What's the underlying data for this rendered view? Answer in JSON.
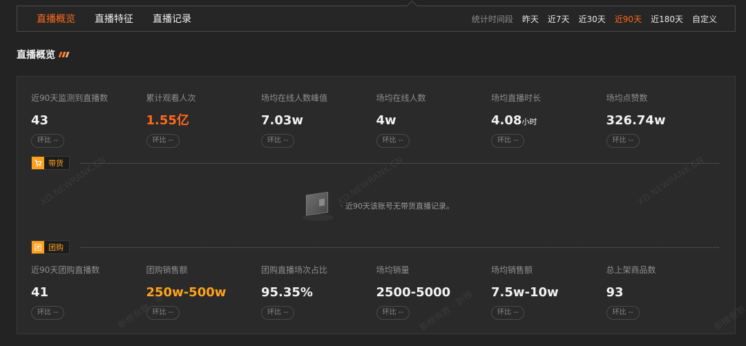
{
  "tabs": [
    {
      "label": "直播概览",
      "active": true
    },
    {
      "label": "直播特征",
      "active": false
    },
    {
      "label": "直播记录",
      "active": false
    }
  ],
  "period": {
    "label": "统计时间段",
    "options": [
      {
        "label": "昨天",
        "active": false
      },
      {
        "label": "近7天",
        "active": false
      },
      {
        "label": "近30天",
        "active": false
      },
      {
        "label": "近90天",
        "active": true
      },
      {
        "label": "近180天",
        "active": false
      },
      {
        "label": "自定义",
        "active": false
      }
    ]
  },
  "section_title": "直播概览",
  "overview_stats": [
    {
      "label": "近90天监测到直播数",
      "value": "43",
      "unit": "",
      "chip": "环比 --"
    },
    {
      "label": "累计观看人次",
      "value": "1.55亿",
      "unit": "",
      "chip": "环比 --"
    },
    {
      "label": "场均在线人数峰值",
      "value": "7.03w",
      "unit": "",
      "chip": "环比 --"
    },
    {
      "label": "场均在线人数",
      "value": "4w",
      "unit": "",
      "chip": "环比 --"
    },
    {
      "label": "场均直播时长",
      "value": "4.08",
      "unit": "小时",
      "chip": "环比 --"
    },
    {
      "label": "场均点赞数",
      "value": "326.74w",
      "unit": "",
      "chip": "环比 --"
    }
  ],
  "goods": {
    "badge": "带货",
    "empty_text": "· 近90天该账号无带货直播记录。"
  },
  "group": {
    "badge": "团购",
    "badge_icon": "团",
    "stats": [
      {
        "label": "近90天团购直播数",
        "value": "41",
        "chip": "环比 --"
      },
      {
        "label": "团购销售额",
        "value": "250w-500w",
        "chip": "环比 --"
      },
      {
        "label": "团购直播场次占比",
        "value": "95.35%",
        "chip": "环比 --"
      },
      {
        "label": "场均销量",
        "value": "2500-5000",
        "chip": "环比 --"
      },
      {
        "label": "场均销售额",
        "value": "7.5w-10w",
        "chip": "环比 --"
      },
      {
        "label": "总上架商品数",
        "value": "93",
        "chip": "环比 --"
      }
    ]
  },
  "watermarks": [
    "XD.NEWRANK.CN",
    "XD.NEWRANK.CN",
    "XD.NEWRANK.CN",
    "新榜有数 · 新",
    "新榜有数 · 新榜",
    "新榜有数"
  ],
  "colors": {
    "accent": "#ff6a1a",
    "gold": "#ffa31a",
    "background": "#232323"
  },
  "icons": {
    "goods_badge": "shopping-cart-icon",
    "empty_state": "empty-box-icon"
  }
}
